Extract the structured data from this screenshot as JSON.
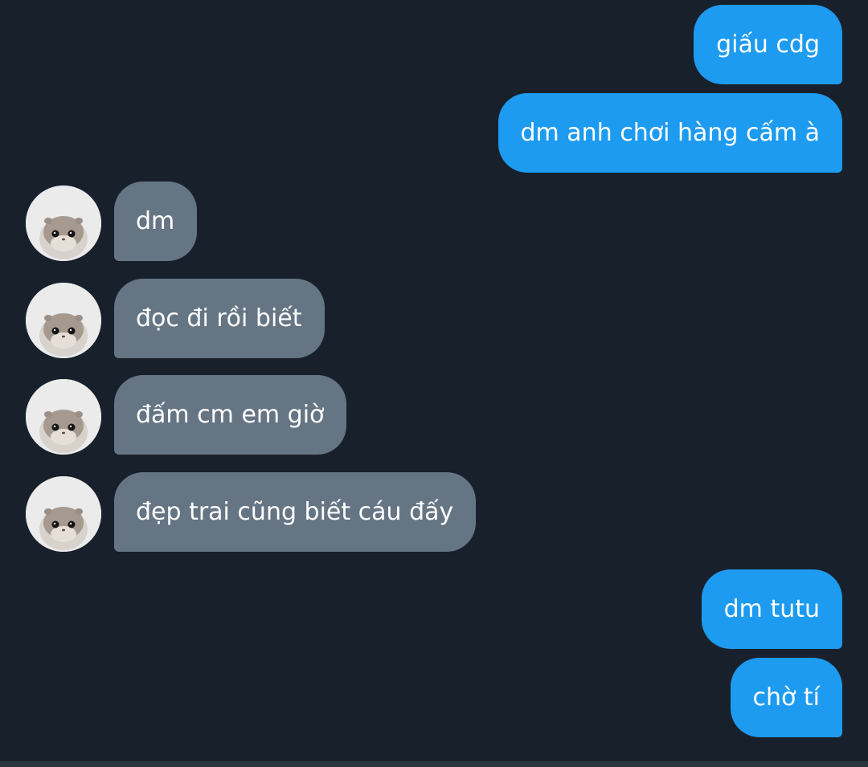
{
  "conversation": {
    "messages": [
      {
        "sender": "me",
        "text": "giấu cdg"
      },
      {
        "sender": "me",
        "text": "dm anh chơi hàng cấm à"
      },
      {
        "sender": "them",
        "text": "dm"
      },
      {
        "sender": "them",
        "text": "đọc đi rồi biết"
      },
      {
        "sender": "them",
        "text": "đấm cm em giờ"
      },
      {
        "sender": "them",
        "text": "đẹp trai cũng biết cáu đấy"
      },
      {
        "sender": "me",
        "text": "dm tutu"
      },
      {
        "sender": "me",
        "text": "chờ tí"
      }
    ]
  },
  "colors": {
    "background": "#18202b",
    "sent_bubble": "#1d9bf0",
    "received_bubble": "#667584",
    "text": "#ffffff"
  },
  "icons": {
    "avatar": "hamster-avatar-icon"
  }
}
